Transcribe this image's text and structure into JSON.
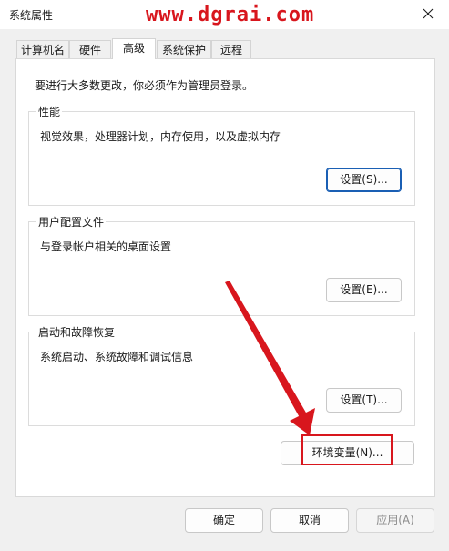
{
  "window": {
    "title": "系统属性",
    "watermark": "www.dgrai.com"
  },
  "tabs": [
    {
      "label": "计算机名",
      "active": false
    },
    {
      "label": "硬件",
      "active": false
    },
    {
      "label": "高级",
      "active": true
    },
    {
      "label": "系统保护",
      "active": false
    },
    {
      "label": "远程",
      "active": false
    }
  ],
  "advanced": {
    "intro": "要进行大多数更改，你必须作为管理员登录。",
    "performance": {
      "title": "性能",
      "description": "视觉效果，处理器计划，内存使用，以及虚拟内存",
      "button": "设置(S)..."
    },
    "user_profiles": {
      "title": "用户配置文件",
      "description": "与登录帐户相关的桌面设置",
      "button": "设置(E)..."
    },
    "startup_recovery": {
      "title": "启动和故障恢复",
      "description": "系统启动、系统故障和调试信息",
      "button": "设置(T)..."
    },
    "env_button": "环境变量(N)..."
  },
  "footer": {
    "ok": "确定",
    "cancel": "取消",
    "apply": "应用(A)"
  },
  "colors": {
    "annotation": "#d8161d",
    "focus": "#1a5fb4"
  }
}
